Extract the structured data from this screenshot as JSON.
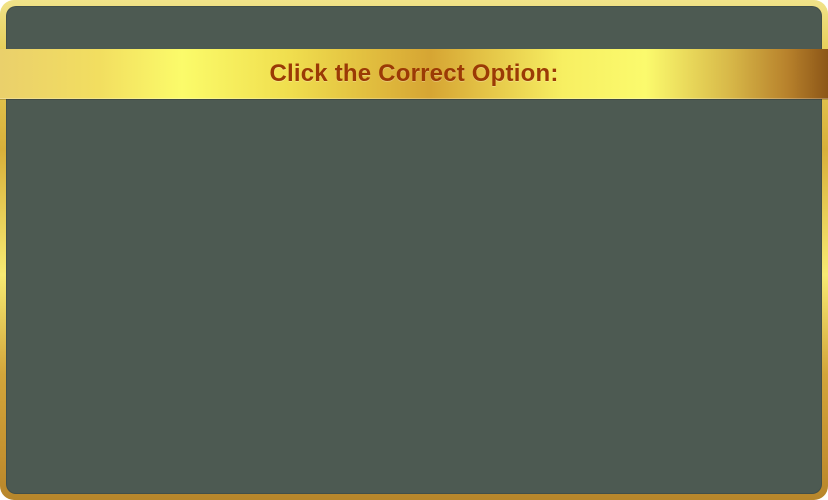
{
  "prompt": {
    "title": "Click the Correct Option:"
  },
  "colors": {
    "panel_bg": "#4d5a52",
    "title_text": "#9b3a05",
    "ribbon_accent": "#fbfb6a",
    "frame_gold": "#d8b03a"
  }
}
